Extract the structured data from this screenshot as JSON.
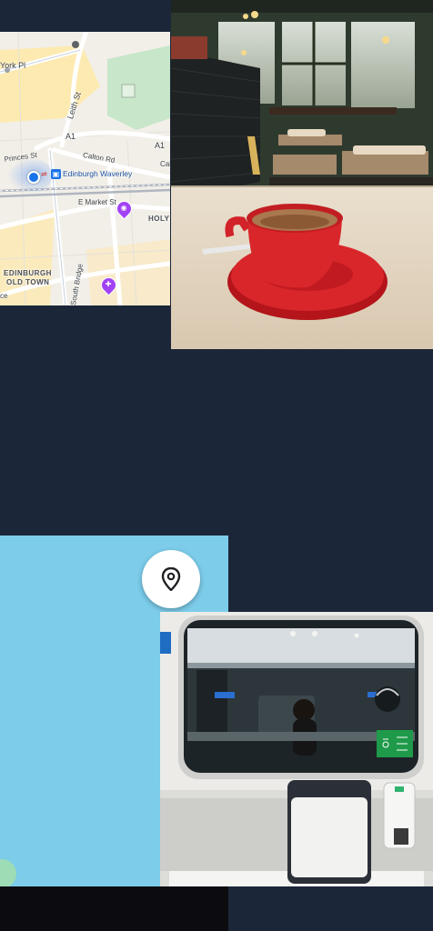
{
  "map": {
    "labels": {
      "york_pl": "York Pl",
      "leith_st": "Leith St",
      "a1_north": "A1",
      "a1_east": "A1",
      "calton_rd": "Calton Rd",
      "cal_cut": "Cal",
      "princes_st": "Princes St",
      "station": "Edinburgh Waverley",
      "e_market_st": "E Market St",
      "holy": "HOLY",
      "old_town_1": "EDINBURGH",
      "old_town_2": "OLD TOWN",
      "south_bridge": "South Bridge",
      "edge_ce": "ce"
    }
  },
  "colors": {
    "background": "#1b2638",
    "map_land": "#f2efe9",
    "map_park": "#c8e6c9",
    "map_road": "#ffffff",
    "map_rail": "#b0b6bf",
    "map_yellow": "#fdeab0",
    "user_location": "#1a73e8",
    "poi": "#a142f4",
    "blue_tile": "#7cccea",
    "fab": "#ffffff"
  },
  "icons": {
    "location_button": "map-pin-icon",
    "station": "train-icon",
    "poi_camera": "camera-icon",
    "poi_food": "restaurant-icon"
  }
}
